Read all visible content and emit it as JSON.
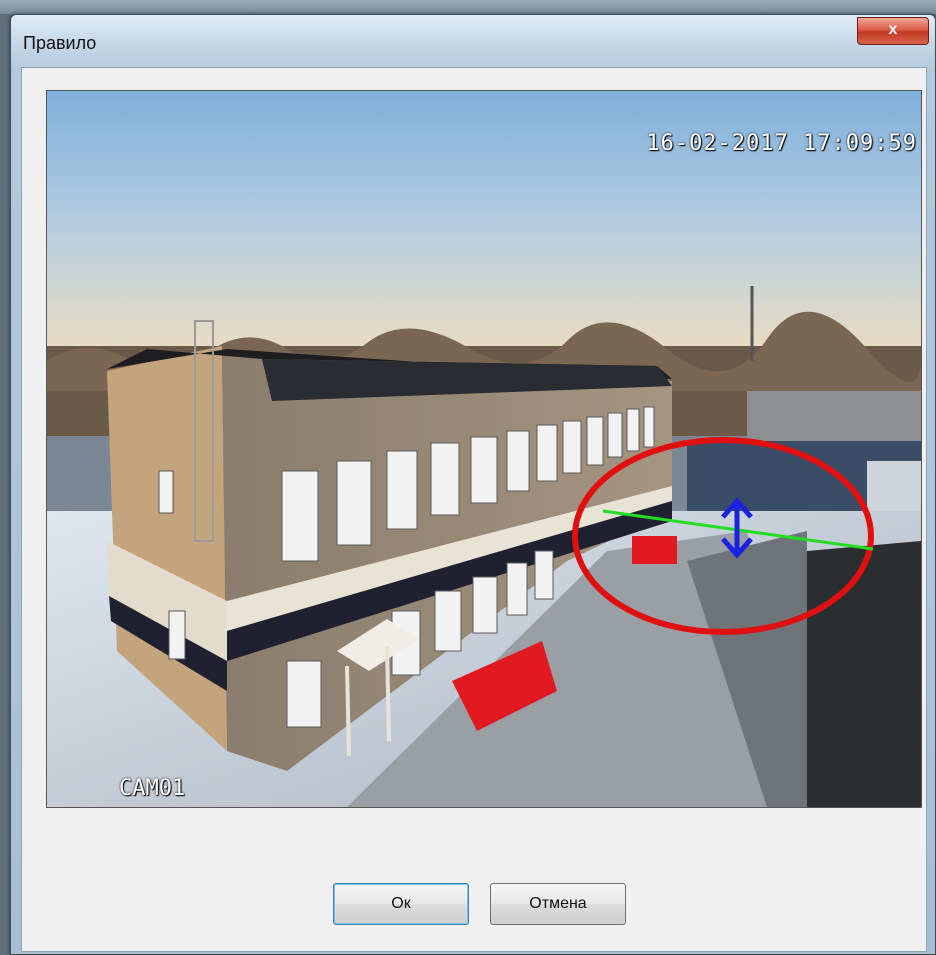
{
  "window": {
    "title": "Правило",
    "close_label": "x"
  },
  "video": {
    "timestamp": "16-02-2017 17:09:59",
    "camera_label": "CAM01"
  },
  "buttons": {
    "ok_label": "Ок",
    "cancel_label": "Отмена"
  },
  "colors": {
    "rule_line": "#22dd22",
    "direction_arrow": "#1a22e0",
    "highlight_ellipse": "#e01010"
  }
}
